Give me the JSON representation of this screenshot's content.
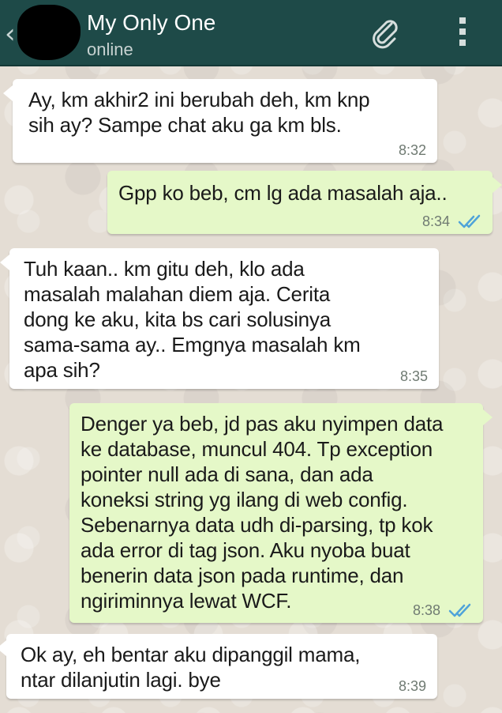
{
  "header": {
    "back_icon": "chevron-left-icon",
    "contact_name": "My Only One",
    "status": "online",
    "attach_icon": "paperclip-icon",
    "menu_icon": "more-vert-icon",
    "color": "#1e4a48"
  },
  "messages": [
    {
      "direction": "incoming",
      "text": "Ay, km akhir2 ini berubah deh, km knp\nsih ay? Sampe chat aku ga km bls.",
      "time": "8:32"
    },
    {
      "direction": "outgoing",
      "text": "Gpp ko beb, cm lg ada masalah aja..",
      "time": "8:34",
      "status_icon": "double-check-icon"
    },
    {
      "direction": "incoming",
      "text": "Tuh kaan.. km gitu deh, klo ada\nmasalah malahan diem aja. Cerita\ndong ke aku, kita bs cari solusinya\nsama-sama ay.. Emgnya masalah km\napa sih?",
      "time": "8:35"
    },
    {
      "direction": "outgoing",
      "text": "Denger ya beb, jd pas aku nyimpen data\nke database, muncul 404. Tp exception\npointer null ada di sana, dan ada\nkoneksi string yg ilang di web config.\nSebenarnya data udh di-parsing, tp kok\nada error di tag json. Aku nyoba buat\nbenerin data json pada runtime, dan\nngiriminnya lewat WCF.",
      "time": "8:38",
      "status_icon": "double-check-icon"
    },
    {
      "direction": "incoming",
      "text": "Ok ay, eh bentar aku dipanggil mama,\nntar dilanjutin lagi. bye",
      "time": "8:39"
    }
  ],
  "colors": {
    "incoming_bubble": "#ffffff",
    "outgoing_bubble": "#e5f8c8",
    "tick": "#4fa3d9"
  }
}
